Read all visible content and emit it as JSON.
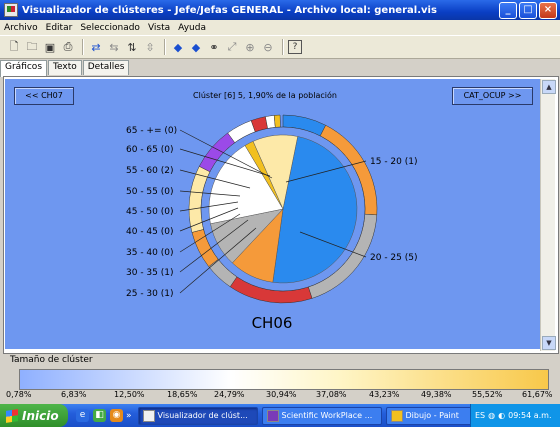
{
  "window": {
    "title": "Visualizador de clústeres - Jefe/Jefas GENERAL - Archivo local: general.vis"
  },
  "menu": [
    "Archivo",
    "Editar",
    "Seleccionado",
    "Vista",
    "Ayuda"
  ],
  "toolbar_icons": [
    "new-icon",
    "open-icon",
    "save-icon",
    "print-icon",
    "swap-icon",
    "swap-disabled-icon",
    "sort-icon",
    "sort-vertical-icon",
    "left-arrow-icon",
    "right-arrow-icon",
    "binoculars-icon",
    "zoom-icon",
    "zoom-in-icon",
    "zoom-out-icon",
    "help-icon"
  ],
  "tabs": [
    "Gráficos",
    "Texto",
    "Detalles"
  ],
  "chart": {
    "prev_button": "<< CH07",
    "next_button": "CAT_OCUP >>",
    "title": "Clúster [6] 5, 1,90% de la población",
    "center_label": "CH06",
    "labels": [
      "65 - += (0)",
      "60 - 65 (0)",
      "55 - 60 (2)",
      "50 - 55 (0)",
      "45 - 50 (0)",
      "40 - 45 (0)",
      "35 - 40 (0)",
      "30 - 35 (1)",
      "25 - 30 (1)",
      "15 - 20 (1)",
      "20 - 25 (5)"
    ]
  },
  "chart_data": {
    "type": "pie",
    "title": "Clúster [6] 5, 1,90% de la población",
    "center_label": "CH06",
    "inner": [
      {
        "category": "20 - 25",
        "count": 5,
        "color": "#2a8aee"
      },
      {
        "category": "25 - 30",
        "count": 1,
        "color": "#f59a3a"
      },
      {
        "category": "30 - 35",
        "count": 1,
        "color": "#b4b4b4"
      },
      {
        "category": "55 - 60",
        "count": 2,
        "color": "#ffffff"
      },
      {
        "category": "65 - +=",
        "count": 0.2,
        "color": "#f2c020"
      },
      {
        "category": "15 - 20",
        "count": 1,
        "color": "#fde9a8"
      }
    ],
    "outer": [
      {
        "color": "#2a8aee",
        "share": 0.075
      },
      {
        "color": "#f59a3a",
        "share": 0.185
      },
      {
        "color": "#b4b4b4",
        "share": 0.19
      },
      {
        "color": "#d83838",
        "share": 0.145
      },
      {
        "color": "#b4b4b4",
        "share": 0.05
      },
      {
        "color": "#f59a3a",
        "share": 0.065
      },
      {
        "color": "#fde9a8",
        "share": 0.115
      },
      {
        "color": "#9b4ae8",
        "share": 0.075
      },
      {
        "color": "#ffffff",
        "share": 0.045
      },
      {
        "color": "#d83838",
        "share": 0.025
      },
      {
        "color": "#ffffff",
        "share": 0.015
      },
      {
        "color": "#f2c020",
        "share": 0.01
      }
    ]
  },
  "cluster_size": {
    "label": "Tamaño de clúster",
    "ticks": [
      "0,78%",
      "6,83%",
      "12,50%",
      "18,65%",
      "24,79%",
      "30,94%",
      "37,08%",
      "43,23%",
      "49,38%",
      "55,52%",
      "61,67%"
    ]
  },
  "taskbar": {
    "start": "Inicio",
    "chevron": "»",
    "tasks": [
      "Visualizador de clúst...",
      "Scientific WorkPlace ...",
      "Dibujo - Paint"
    ],
    "lang": "ES",
    "time": "09:54 a.m."
  }
}
